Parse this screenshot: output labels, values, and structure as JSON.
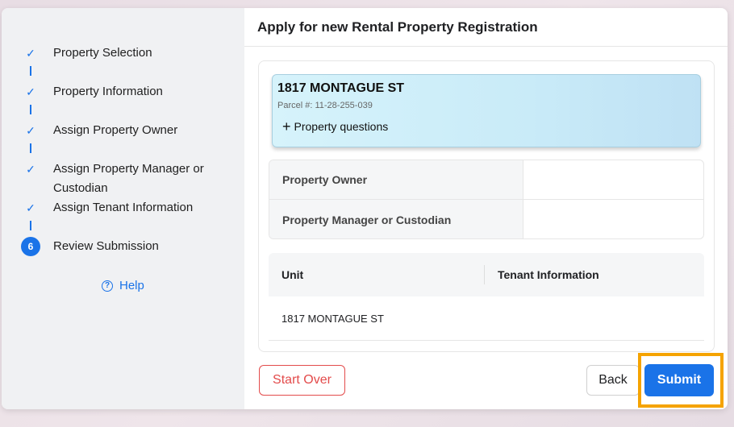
{
  "sidebar": {
    "steps": [
      {
        "label": "Property Selection",
        "marker": "✓"
      },
      {
        "label": "Property Information",
        "marker": "✓"
      },
      {
        "label": "Assign Property Owner",
        "marker": "✓"
      },
      {
        "label": "Assign Property Manager or Custodian",
        "marker": "✓"
      },
      {
        "label": "Assign Tenant Information",
        "marker": "✓"
      },
      {
        "label": "Review Submission",
        "marker": "6"
      }
    ],
    "help_icon": "?",
    "help_label": "Help"
  },
  "header": {
    "title": "Apply for new Rental Property Registration"
  },
  "property": {
    "address": "1817 MONTAGUE ST",
    "parcel": "Parcel #: 11-28-255-039",
    "questions_label": "Property questions",
    "questions_icon": "+"
  },
  "owner_table": {
    "rows": [
      {
        "key": "Property Owner",
        "value": ""
      },
      {
        "key": "Property Manager or Custodian",
        "value": ""
      }
    ]
  },
  "unit_table": {
    "headers": [
      "Unit",
      "Tenant Information"
    ],
    "rows": [
      [
        "1817 MONTAGUE ST",
        ""
      ]
    ]
  },
  "actions": {
    "start_over": "Start Over",
    "back": "Back",
    "submit": "Submit"
  },
  "colors": {
    "accent": "#1a73e8",
    "danger": "#e34b4b",
    "highlight": "#f5a300"
  }
}
